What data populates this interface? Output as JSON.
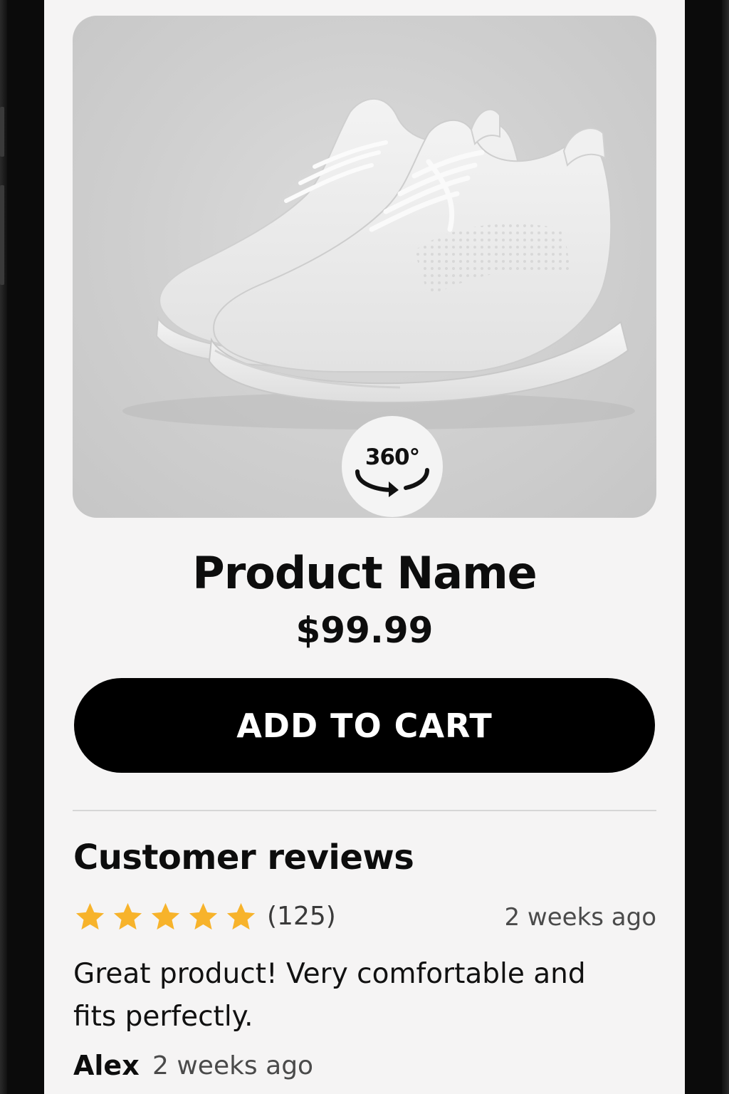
{
  "product": {
    "image_alt": "white knit sneakers",
    "view360_label": "360°",
    "name": "Product Name",
    "price": "$99.99",
    "add_to_cart_label": "ADD TO CART"
  },
  "reviews": {
    "title": "Customer reviews",
    "rating_stars": 5,
    "rating_max": 5,
    "star_color": "#F7B32B",
    "count_label": "(125)",
    "summary_time": "2 weeks ago",
    "items": [
      {
        "text": "Great product! Very comfortable and fits perfectly.",
        "author": "Alex",
        "time": "2 weeks ago"
      }
    ]
  },
  "colors": {
    "button_bg": "#000000",
    "screen_bg": "#F5F4F4"
  }
}
